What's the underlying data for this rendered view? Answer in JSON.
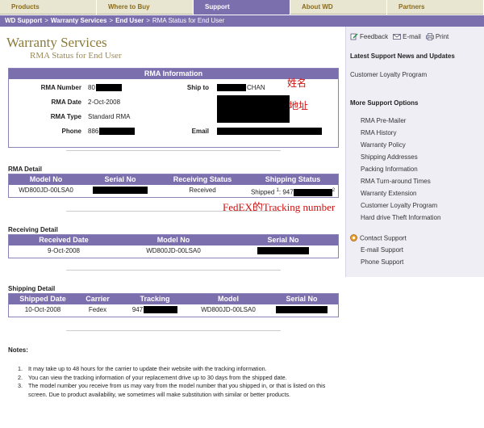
{
  "nav": {
    "tabs": [
      "Products",
      "Where to Buy",
      "Support",
      "About WD",
      "Partners"
    ],
    "active": 2
  },
  "breadcrumb": [
    "WD Support",
    "Warranty Services",
    "End User",
    "RMA Status for End User"
  ],
  "page": {
    "title": "Warranty Services",
    "subtitle": "RMA Status for End User"
  },
  "rma_info": {
    "header": "RMA Information",
    "rma_number_label": "RMA Number",
    "rma_number_value": "80",
    "rma_date_label": "RMA Date",
    "rma_date_value": "2-Oct-2008",
    "rma_type_label": "RMA Type",
    "rma_type_value": "Standard RMA",
    "phone_label": "Phone",
    "phone_value": "886",
    "ship_to_label": "Ship to",
    "ship_to_name": "CHAN",
    "email_label": "Email"
  },
  "annotations": {
    "name": "姓名",
    "address": "地址",
    "tracking": "FedEX的Tracking number"
  },
  "rma_detail": {
    "title": "RMA Detail",
    "columns": [
      "Model No",
      "Serial No",
      "Receiving Status",
      "Shipping Status"
    ],
    "row": {
      "model": "WD800JD-00LSA0",
      "receiving": "Received",
      "shipping_prefix": "Shipped",
      "sup1": "1",
      "tracking_prefix": "947",
      "sup2": "2"
    }
  },
  "receiving_detail": {
    "title": "Receiving Detail",
    "columns": [
      "Received Date",
      "Model No",
      "Serial No"
    ],
    "row": {
      "date": "9-Oct-2008",
      "model": "WD800JD-00LSA0"
    }
  },
  "shipping_detail": {
    "title": "Shipping Detail",
    "columns": [
      "Shipped Date",
      "Carrier",
      "Tracking",
      "Model",
      "Serial No"
    ],
    "row": {
      "date": "10-Oct-2008",
      "carrier": "Fedex",
      "tracking": "947",
      "model": "WD800JD-00LSA0"
    }
  },
  "notes": {
    "title": "Notes:",
    "items": [
      "It may take up to 48 hours for the carrier to update their website with the tracking information.",
      "You can view the tracking information of your replacement drive up to 30 days from the shipped date.",
      "The model number you receive from us may vary from the model number that you shipped in, or that is listed on this screen.  Due to product availability, we sometimes will make substitution with similar or better products."
    ]
  },
  "sidebar": {
    "feedback": "Feedback",
    "email": "E-mail",
    "print": "Print",
    "news_heading": "Latest Support News and Updates",
    "loyalty": "Customer Loyalty Program",
    "options_heading": "More Support Options",
    "options": [
      "RMA Pre-Mailer",
      "RMA History",
      "Warranty Policy",
      "Shipping Addresses",
      "Packing Information",
      "RMA Turn-around Times",
      "Warranty Extension",
      "Customer Loyalty Program",
      "Hard drive Theft Information"
    ],
    "contact_heading": "Contact Support",
    "contact_links": [
      "E-mail Support",
      "Phone Support"
    ]
  },
  "colors": {
    "accent": "#7b6fae",
    "title": "#8a7a3a",
    "annotation": "#d01010"
  }
}
